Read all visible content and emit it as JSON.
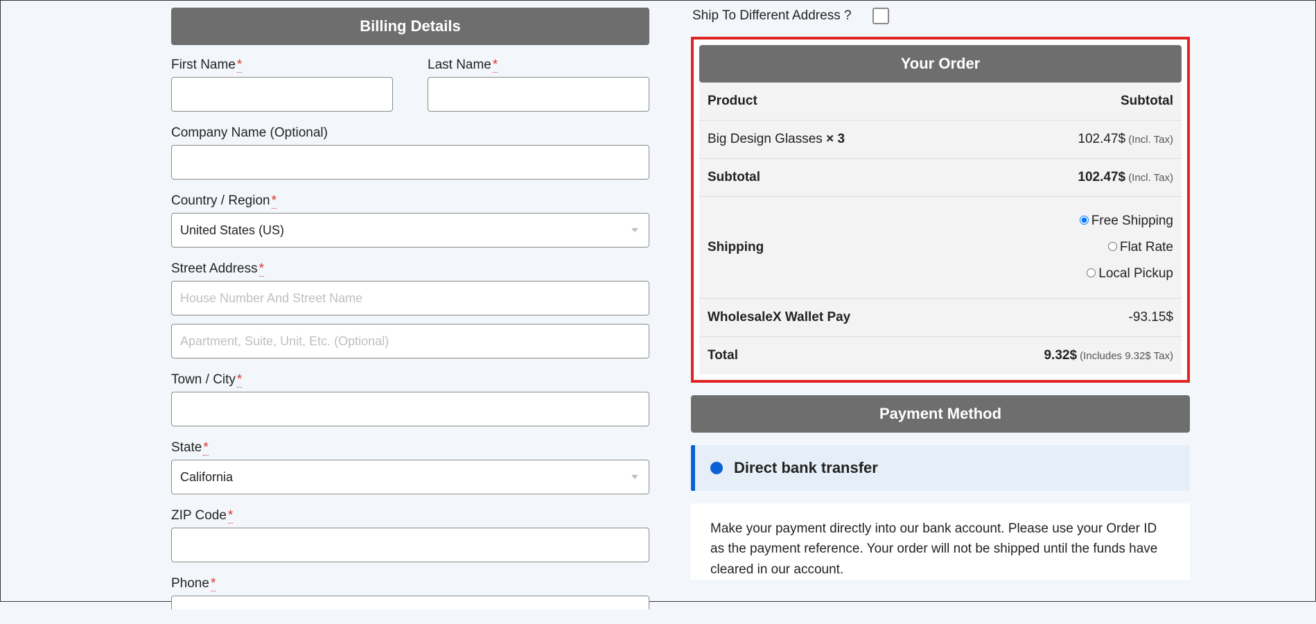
{
  "billing": {
    "header": "Billing Details",
    "first_name_label": "First Name",
    "last_name_label": "Last Name",
    "company_label": "Company Name (Optional)",
    "country_label": "Country / Region",
    "country_value": "United States (US)",
    "street_label": "Street Address",
    "street_placeholder": "House Number And Street Name",
    "street2_placeholder": "Apartment, Suite, Unit, Etc. (Optional)",
    "city_label": "Town / City",
    "state_label": "State",
    "state_value": "California",
    "zip_label": "ZIP Code",
    "phone_label": "Phone"
  },
  "ship_diff": {
    "label": "Ship To Different Address ?"
  },
  "order": {
    "header": "Your Order",
    "product_col": "Product",
    "subtotal_col": "Subtotal",
    "item_name": "Big Design Glasses ",
    "item_qty": " × 3",
    "item_price": "102.47$",
    "incl_tax": " (Incl. Tax)",
    "subtotal_label": "Subtotal",
    "subtotal_value": "102.47$",
    "shipping_label": "Shipping",
    "ship_free": "Free Shipping",
    "ship_flat": "Flat Rate",
    "ship_local": "Local Pickup",
    "wallet_label": "WholesaleX Wallet Pay",
    "wallet_value": "-93.15$",
    "total_label": "Total",
    "total_value": "9.32$",
    "total_tax": " (Includes 9.32$ Tax)"
  },
  "payment": {
    "header": "Payment Method",
    "method": "Direct bank transfer",
    "desc": "Make your payment directly into our bank account. Please use your Order ID as the payment reference. Your order will not be shipped until the funds have cleared in our account."
  }
}
